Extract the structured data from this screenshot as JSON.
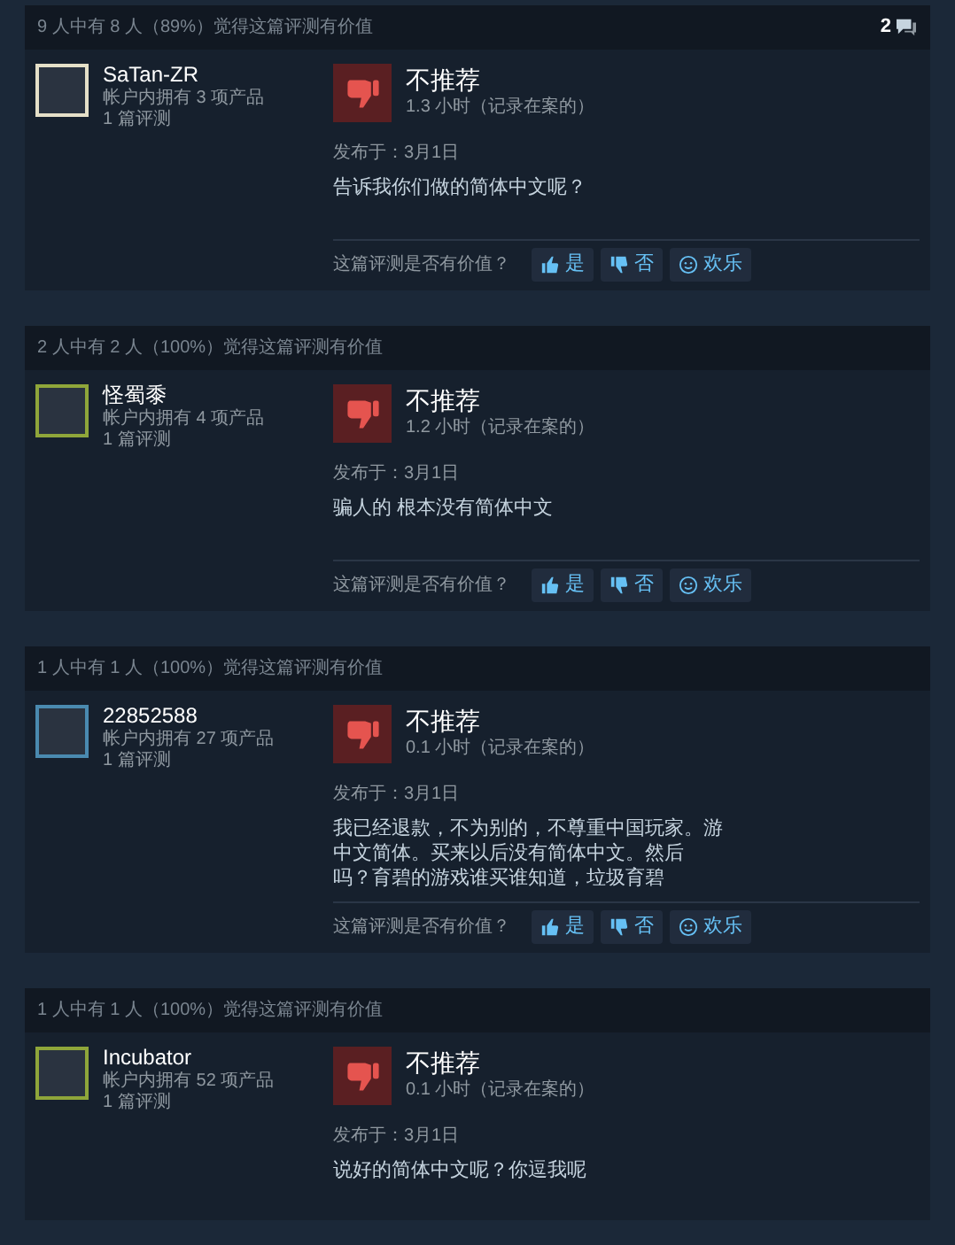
{
  "reviews": [
    {
      "helpful": "9 人中有 8 人（89%）觉得这篇评测有价值",
      "comments": "2",
      "user": {
        "name": "SaTan-ZR",
        "products": "帐户内拥有 3 项产品",
        "reviews": "1 篇评测",
        "color": "#e5e0c8"
      },
      "verdict": "不推荐",
      "hours": "1.3 小时（记录在案的）",
      "posted": "发布于：3月1日",
      "text": [
        "告诉我你们做的简体中文呢？"
      ],
      "prompt": "这篇评测是否有价值？",
      "buttons": [
        {
          "kind": "yes",
          "label": "是"
        },
        {
          "kind": "no",
          "label": "否"
        },
        {
          "kind": "funny",
          "label": "欢乐"
        }
      ]
    },
    {
      "helpful": "2 人中有 2 人（100%）觉得这篇评测有价值",
      "user": {
        "name": "怪蜀黍",
        "products": "帐户内拥有 4 项产品",
        "reviews": "1 篇评测",
        "color": "#8fa63a"
      },
      "verdict": "不推荐",
      "hours": "1.2 小时（记录在案的）",
      "posted": "发布于：3月1日",
      "text": [
        "骗人的 根本没有简体中文"
      ],
      "prompt": "这篇评测是否有价值？",
      "buttons": [
        {
          "kind": "yes",
          "label": "是"
        },
        {
          "kind": "no",
          "label": "否"
        },
        {
          "kind": "funny",
          "label": "欢乐"
        }
      ]
    },
    {
      "helpful": "1 人中有 1 人（100%）觉得这篇评测有价值",
      "user": {
        "name": "22852588",
        "products": "帐户内拥有 27 项产品",
        "reviews": "1 篇评测",
        "color": "#4a8ab0"
      },
      "verdict": "不推荐",
      "hours": "0.1 小时（记录在案的）",
      "posted": "发布于：3月1日",
      "text": [
        "我已经退款，不为别的，不尊重中国玩家。游",
        "中文简体。买来以后没有简体中文。然后",
        "吗？育碧的游戏谁买谁知道，垃圾育碧"
      ],
      "prompt": "这篇评测是否有价值？",
      "buttons": [
        {
          "kind": "yes",
          "label": "是"
        },
        {
          "kind": "no",
          "label": "否"
        },
        {
          "kind": "funny",
          "label": "欢乐"
        }
      ]
    },
    {
      "helpful": "1 人中有 1 人（100%）觉得这篇评测有价值",
      "user": {
        "name": "Incubator",
        "products": "帐户内拥有 52 项产品",
        "reviews": "1 篇评测",
        "color": "#8fa63a"
      },
      "verdict": "不推荐",
      "hours": "0.1 小时（记录在案的）",
      "posted": "发布于：3月1日",
      "text": [
        "说好的简体中文呢？你逗我呢"
      ]
    }
  ]
}
